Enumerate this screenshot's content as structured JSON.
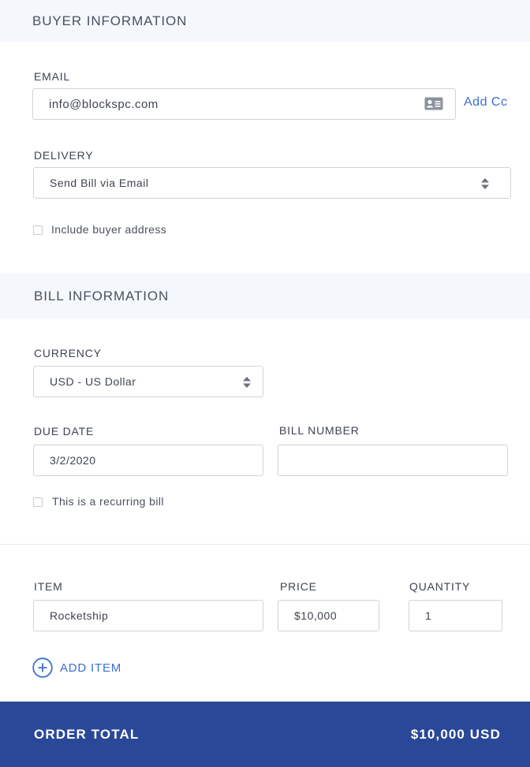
{
  "buyer": {
    "section_title": "BUYER INFORMATION",
    "email_label": "EMAIL",
    "email_value": "info@blockspc.com",
    "add_cc": "Add Cc",
    "delivery_label": "DELIVERY",
    "delivery_value": "Send Bill via Email",
    "include_address_label": "Include buyer address"
  },
  "bill": {
    "section_title": "BILL INFORMATION",
    "currency_label": "CURRENCY",
    "currency_value": "USD - US Dollar",
    "due_date_label": "DUE DATE",
    "due_date_value": "3/2/2020",
    "bill_number_label": "BILL NUMBER",
    "bill_number_value": "",
    "recurring_label": "This is a recurring bill"
  },
  "items": {
    "item_label": "ITEM",
    "price_label": "PRICE",
    "quantity_label": "QUANTITY",
    "rows": [
      {
        "item": "Rocketship",
        "price": "$10,000",
        "quantity": "1"
      }
    ],
    "add_item": "ADD ITEM"
  },
  "order": {
    "total_label": "ORDER TOTAL",
    "total_value": "$10,000 USD"
  },
  "colors": {
    "accent": "#3b6fd4",
    "footer": "#2b4898",
    "section_bg": "#f4f7fb"
  },
  "icons": [
    "contact-card-icon",
    "select-arrows-icon",
    "plus-circle-icon"
  ]
}
